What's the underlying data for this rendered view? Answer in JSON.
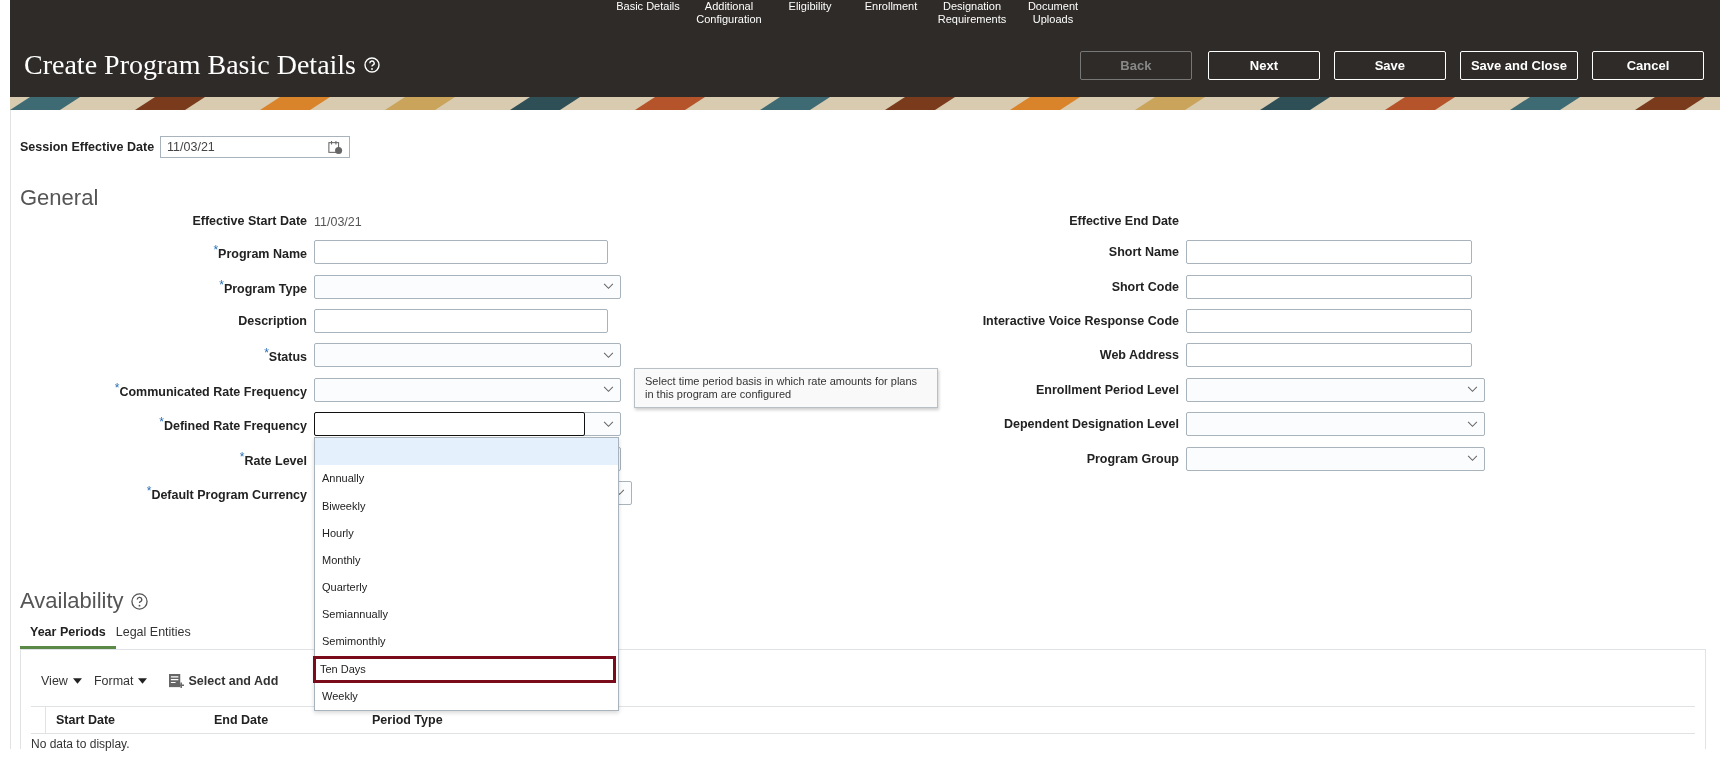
{
  "train_steps": [
    "Basic Details",
    "Additional Configuration",
    "Eligibility",
    "Enrollment",
    "Designation Requirements",
    "Document Uploads"
  ],
  "title": "Create Program Basic Details",
  "buttons": [
    {
      "label": "Back",
      "disabled": true
    },
    {
      "label": "Next",
      "disabled": false
    },
    {
      "label": "Save",
      "disabled": false
    },
    {
      "label": "Save and Close",
      "disabled": false
    },
    {
      "label": "Cancel",
      "disabled": false
    }
  ],
  "session_date": {
    "label": "Session Effective Date",
    "value": "11/03/21"
  },
  "general": {
    "heading": "General",
    "left_fields": [
      {
        "label": "Effective Start Date",
        "kind": "readonly",
        "value": "11/03/21"
      },
      {
        "label": "Program Name",
        "required_mark": "*",
        "kind": "text"
      },
      {
        "label": "Program Type",
        "required_mark": "*",
        "kind": "select"
      },
      {
        "label": "Description",
        "kind": "text"
      },
      {
        "label": "Status",
        "required_mark": "*",
        "kind": "select"
      },
      {
        "label": "Communicated Rate Frequency",
        "required_mark": "*",
        "kind": "select"
      },
      {
        "label": "Defined Rate Frequency",
        "required_mark": "*",
        "kind": "select",
        "focused": true
      },
      {
        "label": "Rate Level",
        "required_mark": "*",
        "kind": "select_covered"
      },
      {
        "label": "Default Program Currency",
        "required_mark": "*",
        "kind": "select"
      }
    ],
    "right_fields": [
      {
        "label": "Effective End Date",
        "kind": "readonly"
      },
      {
        "label": "Short Name",
        "kind": "text"
      },
      {
        "label": "Short Code",
        "kind": "text"
      },
      {
        "label": "Interactive Voice Response Code",
        "kind": "text"
      },
      {
        "label": "Web Address",
        "kind": "text"
      },
      {
        "label": "Enrollment Period Level",
        "kind": "select"
      },
      {
        "label": "Dependent Designation Level",
        "kind": "select"
      },
      {
        "label": "Program Group",
        "kind": "select"
      }
    ]
  },
  "tooltip": "Select time period basis in which rate amounts for plans in this program are configured",
  "dropdown": {
    "items": [
      {
        "selected": true,
        "outlined": false
      },
      {
        "label": "Annually",
        "selected": false,
        "outlined": false
      },
      {
        "label": "Biweekly",
        "selected": false,
        "outlined": false
      },
      {
        "label": "Hourly",
        "selected": false,
        "outlined": false
      },
      {
        "label": "Monthly",
        "selected": false,
        "outlined": false
      },
      {
        "label": "Quarterly",
        "selected": false,
        "outlined": false
      },
      {
        "label": "Semiannually",
        "selected": false,
        "outlined": false
      },
      {
        "label": "Semimonthly",
        "selected": false,
        "outlined": false
      },
      {
        "label": "Ten Days",
        "selected": false,
        "outlined": true
      },
      {
        "label": "Weekly",
        "selected": false,
        "outlined": false
      }
    ]
  },
  "availability": {
    "heading": "Availability",
    "tabs": [
      {
        "label": "Year Periods",
        "selected": true
      },
      {
        "label": "Legal Entities",
        "selected": false
      }
    ],
    "toolbar": [
      {
        "label": "View",
        "kind": "menu"
      },
      {
        "label": "Format",
        "kind": "menu"
      },
      {
        "label": "Select and Add",
        "kind": "action"
      }
    ],
    "columns": [
      "Start Date",
      "End Date",
      "Period Type"
    ],
    "empty_text": "No data to display."
  }
}
